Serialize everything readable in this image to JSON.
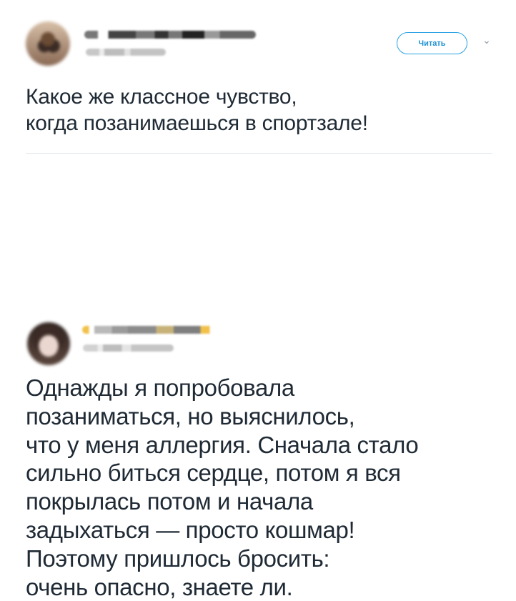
{
  "tweets": [
    {
      "button_label": "Читать",
      "chevron": "⌄",
      "text": "Какое же классное чувство,\nкогда позанимаешься в спортзале!"
    },
    {
      "text": "Однажды я попробовала\nпозаниматься, но выяснилось,\nчто у меня аллергия. Сначала стало\nсильно биться сердце, потом я вся\nпокрылась потом и начала\nзадыхаться — просто кошмар!\nПоэтому пришлось бросить:\nочень опасно, знаете ли."
    }
  ],
  "colors": {
    "accent": "#2aa1e3",
    "text": "#1f2a35",
    "divider": "#e4e8ec"
  },
  "icons": {
    "chevron": "chevron-down-icon"
  }
}
